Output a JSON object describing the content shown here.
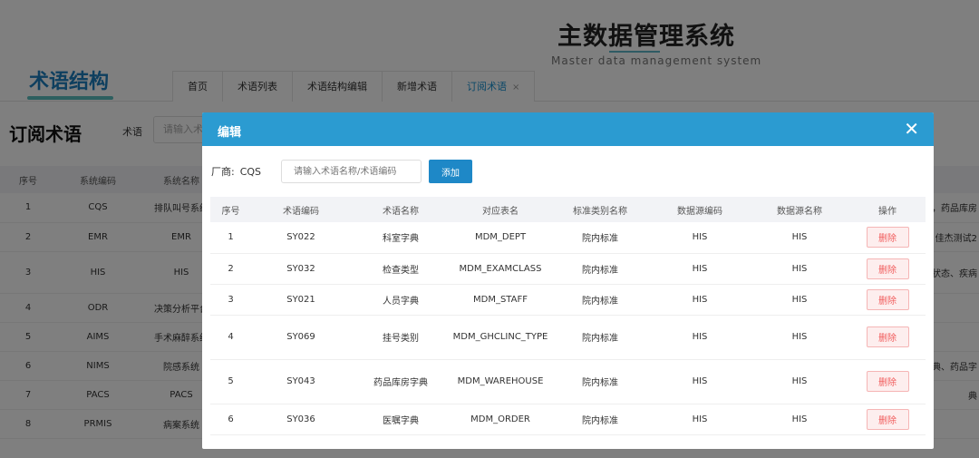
{
  "header": {
    "system_title": "主数据管理系统",
    "system_subtitle": "Master data management system",
    "brand": "术语结构"
  },
  "tabs": [
    {
      "label": "首页"
    },
    {
      "label": "术语列表"
    },
    {
      "label": "术语结构编辑"
    },
    {
      "label": "新增术语"
    },
    {
      "label": "订阅术语",
      "close": "×"
    }
  ],
  "page": {
    "section_title": "订阅术语",
    "term_label": "术语",
    "term_placeholder": "请输入术"
  },
  "bg_table": {
    "headers": [
      "序号",
      "系统编码",
      "系统名称"
    ],
    "rows": [
      {
        "no": "1",
        "code": "CQS",
        "name": "排队叫号系统",
        "extra": "，药品库房"
      },
      {
        "no": "2",
        "code": "EMR",
        "name": "EMR",
        "extra": "佳杰测试2"
      },
      {
        "no": "3",
        "code": "HIS",
        "name": "HIS",
        "extra": "状态、疾病"
      },
      {
        "no": "4",
        "code": "ODR",
        "name": "决策分析平台",
        "extra": ""
      },
      {
        "no": "5",
        "code": "AIMS",
        "name": "手术麻醉系统",
        "extra": ""
      },
      {
        "no": "6",
        "code": "NIMS",
        "name": "院感系统",
        "extra": "典、药品字"
      },
      {
        "no": "7",
        "code": "PACS",
        "name": "PACS",
        "extra": "典"
      },
      {
        "no": "8",
        "code": "PRMIS",
        "name": "病案系统",
        "extra": ""
      }
    ]
  },
  "modal": {
    "title": "编辑",
    "close_symbol": "✕",
    "vendor_label": "厂商:",
    "vendor_value": "CQS",
    "search_placeholder": "请输入术语名称/术语编码",
    "add_label": "添加",
    "delete_label": "删除",
    "headers": [
      "序号",
      "术语编码",
      "术语名称",
      "对应表名",
      "标准类别名称",
      "数据源编码",
      "数据源名称",
      "操作"
    ],
    "rows": [
      {
        "no": "1",
        "code": "SY022",
        "name": "科室字典",
        "table": "MDM_DEPT",
        "category": "院内标准",
        "src_code": "HIS",
        "src_name": "HIS"
      },
      {
        "no": "2",
        "code": "SY032",
        "name": "检查类型",
        "table": "MDM_EXAMCLASS",
        "category": "院内标准",
        "src_code": "HIS",
        "src_name": "HIS"
      },
      {
        "no": "3",
        "code": "SY021",
        "name": "人员字典",
        "table": "MDM_STAFF",
        "category": "院内标准",
        "src_code": "HIS",
        "src_name": "HIS"
      },
      {
        "no": "4",
        "code": "SY069",
        "name": "挂号类别",
        "table": "MDM_GHCLINC_TYPE",
        "category": "院内标准",
        "src_code": "HIS",
        "src_name": "HIS"
      },
      {
        "no": "5",
        "code": "SY043",
        "name": "药品库房字典",
        "table": "MDM_WAREHOUSE",
        "category": "院内标准",
        "src_code": "HIS",
        "src_name": "HIS"
      },
      {
        "no": "6",
        "code": "SY036",
        "name": "医嘱字典",
        "table": "MDM_ORDER",
        "category": "院内标准",
        "src_code": "HIS",
        "src_name": "HIS"
      }
    ]
  }
}
